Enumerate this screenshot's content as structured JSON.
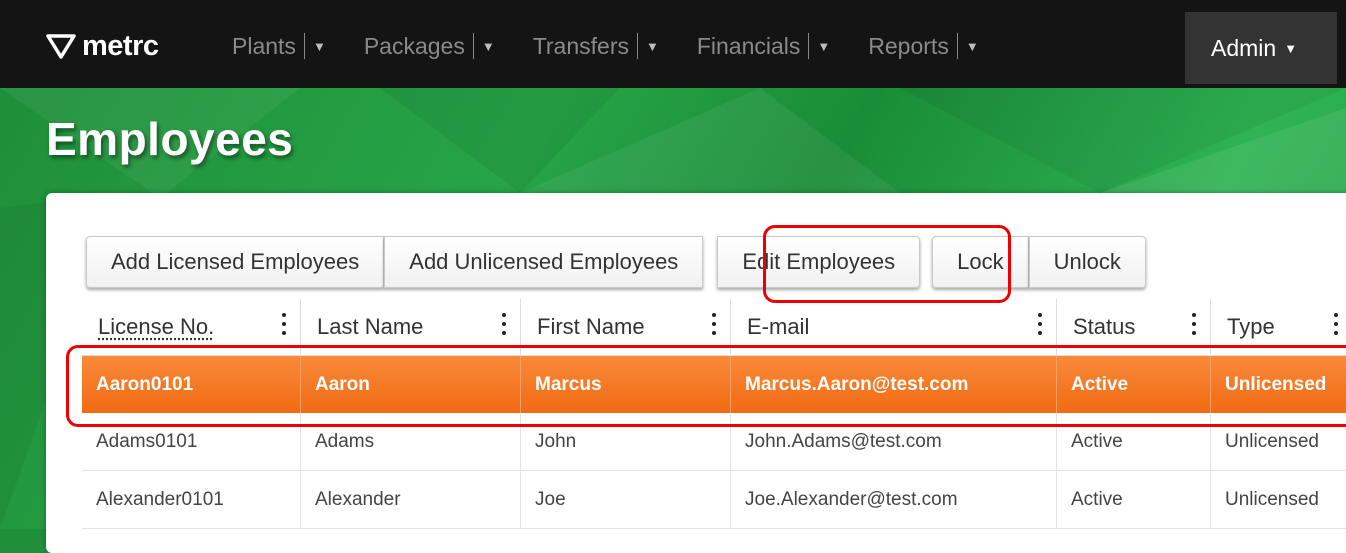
{
  "brand": {
    "name": "metrc"
  },
  "nav": {
    "items": [
      {
        "label": "Plants"
      },
      {
        "label": "Packages"
      },
      {
        "label": "Transfers"
      },
      {
        "label": "Financials"
      },
      {
        "label": "Reports"
      }
    ],
    "active": {
      "label": "Admin"
    }
  },
  "page": {
    "title": "Employees"
  },
  "toolbar": {
    "add_licensed": "Add Licensed Employees",
    "add_unlicensed": "Add Unlicensed Employees",
    "edit": "Edit Employees",
    "lock": "Lock",
    "unlock": "Unlock"
  },
  "table": {
    "columns": [
      "License No.",
      "Last Name",
      "First Name",
      "E-mail",
      "Status",
      "Type"
    ],
    "rows": [
      [
        "Aaron0101",
        "Aaron",
        "Marcus",
        "Marcus.Aaron@test.com",
        "Active",
        "Unlicensed"
      ],
      [
        "Adams0101",
        "Adams",
        "John",
        "John.Adams@test.com",
        "Active",
        "Unlicensed"
      ],
      [
        "Alexander0101",
        "Alexander",
        "Joe",
        "Joe.Alexander@test.com",
        "Active",
        "Unlicensed"
      ]
    ]
  },
  "colors": {
    "selected_row": "#f26a12",
    "highlight": "#e00000",
    "nav_bg": "#141414",
    "banner": "#1f8f3a"
  }
}
